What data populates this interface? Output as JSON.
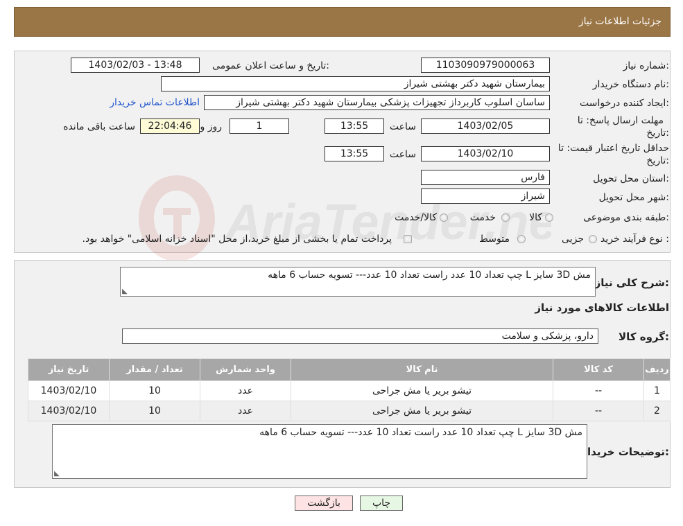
{
  "header": {
    "title": "جزئیات اطلاعات نیاز"
  },
  "form": {
    "need_number_label": "شماره نیاز:",
    "need_number": "1103090979000063",
    "announce_label": "تاریخ و ساعت اعلان عمومی:",
    "announce_value": "1403/02/03 - 13:48",
    "buyer_org_label": "نام دستگاه خریدار:",
    "buyer_org": "بیمارستان شهید دکتر بهشتی شیراز",
    "creator_label": "ایجاد کننده درخواست:",
    "creator": "ساسان اسلوب کاربرداز  تجهیزات پزشکی بیمارستان شهید دکتر بهشتی شیراز",
    "contact_link": "اطلاعات تماس خریدار",
    "deadline_label_1": "مهلت ارسال پاسخ: تا",
    "deadline_label_2": "تاریخ:",
    "deadline_date": "1403/02/05",
    "hour_label": "ساعت",
    "deadline_time": "13:55",
    "days_value": "1",
    "days_label": "روز و",
    "remaining_time": "22:04:46",
    "remaining_label": "ساعت باقی مانده",
    "validity_label_1": "حداقل تاریخ اعتبار قیمت: تا",
    "validity_label_2": "تاریخ:",
    "validity_date": "1403/02/10",
    "validity_hour_label": "ساعت",
    "validity_time": "13:55",
    "province_label": "استان محل تحویل:",
    "province": "فارس",
    "city_label": "شهر محل تحویل:",
    "city": "شیراز",
    "category_label": "طبقه بندی موضوعی:",
    "category_options": [
      "کالا",
      "خدمت",
      "کالا/خدمت"
    ],
    "process_label": "نوع فرآیند خرید :",
    "process_options": [
      "جزیی",
      "متوسط"
    ],
    "payment_note": "پرداخت تمام یا بخشی از مبلغ خرید،از محل \"اسناد خزانه اسلامی\" خواهد بود."
  },
  "watermark": {
    "text": "AriaTender.neT"
  },
  "details": {
    "description_label": "شرح کلی نیاز:",
    "description": "مش 3D سایز L چپ تعداد 10 عدد راست تعداد 10 عدد--- تسویه حساب 6 ماهه",
    "goods_info_title": "اطلاعات کالاهای مورد نیاز",
    "goods_group_label": "گروه کالا:",
    "goods_group": "دارو، پزشکی و سلامت",
    "table": {
      "headers": [
        "ردیف",
        "کد کالا",
        "نام کالا",
        "واحد شمارش",
        "تعداد / مقدار",
        "تاریخ نیاز"
      ],
      "rows": [
        {
          "idx": "1",
          "code": "--",
          "name": "تیشو بریر یا مش جراحی",
          "unit": "عدد",
          "qty": "10",
          "date": "1403/02/10"
        },
        {
          "idx": "2",
          "code": "--",
          "name": "تیشو بریر یا مش جراحی",
          "unit": "عدد",
          "qty": "10",
          "date": "1403/02/10"
        }
      ]
    },
    "buyer_notes_label": "توضیحات خریدار:",
    "buyer_notes": "مش 3D سایز L چپ تعداد 10 عدد راست تعداد 10 عدد--- تسویه حساب 6 ماهه"
  },
  "buttons": {
    "print": "چاپ",
    "back": "بازگشت"
  },
  "colors": {
    "header_bg": "#9a7545",
    "table_header_bg": "#a7a7a7",
    "link": "#2255cc",
    "timer_bg": "#fdfcd7",
    "back_button_bg": "#fde3e3",
    "print_button_bg": "#e6f7e3"
  }
}
